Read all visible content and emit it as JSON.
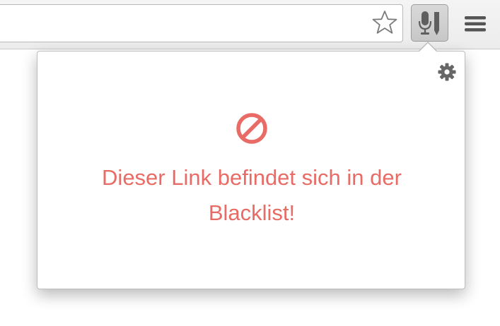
{
  "toolbar": {
    "icons": {
      "bookmark": "star-icon",
      "extension": "microphone-pencil-icon",
      "menu": "hamburger-menu-icon"
    }
  },
  "popup": {
    "settings_icon": "gear-icon",
    "status_icon": "blocked-icon",
    "message_line1": "Dieser Link befindet sich in der",
    "message_line2": "Blacklist!"
  },
  "colors": {
    "message": "#e96b65",
    "icon_gray": "#666666"
  }
}
